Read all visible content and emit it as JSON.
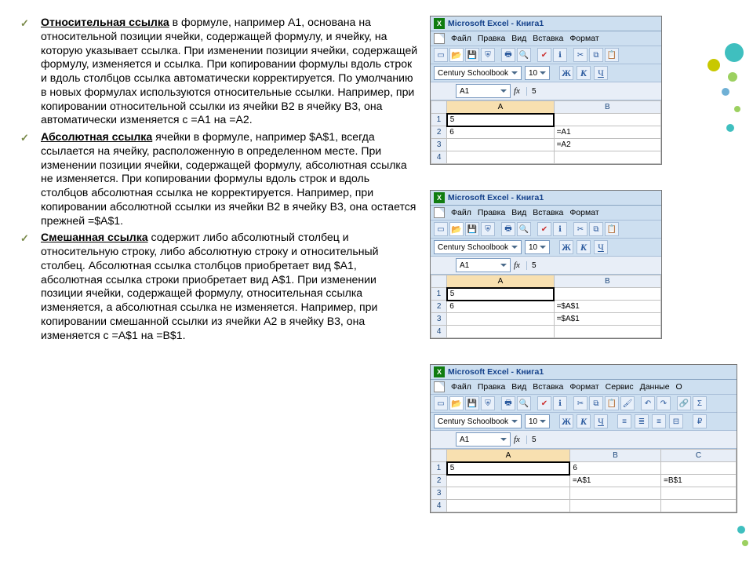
{
  "text": {
    "p1_lead": "Относительная ссылка",
    "p1_body": " в формуле, например A1, основана на относительной позиции ячейки, содержащей формулу, и ячейку, на которую указывает ссылка. При изменении позиции ячейки, содержащей формулу, изменяется и ссылка. При копировании формулы вдоль строк и вдоль столбцов ссылка автоматически корректируется. По умолчанию в новых формулах используются относительные ссылки. Например, при копировании относительной ссылки из ячейки B2 в ячейку B3, она автоматически изменяется с =A1 на =A2.",
    "p2_lead": "Абсолютная ссылка",
    "p2_body": "  ячейки в формуле, например $A$1, всегда ссылается на ячейку, расположенную в определенном месте. При изменении позиции ячейки, содержащей формулу, абсолютная ссылка не изменяется. При копировании формулы вдоль строк и вдоль столбцов абсолютная ссылка не корректируется. Например, при копировании абсолютной ссылки из ячейки B2 в ячейку B3, она остается прежней =$A$1.",
    "p3_lead": "Смешанная ссылка",
    "p3_body": " содержит либо абсолютный столбец и относительную строку, либо абсолютную строку и относительный столбец. Абсолютная ссылка столбцов приобретает вид $A1, абсолютная ссылка строки приобретает вид A$1. При изменении позиции ячейки, содержащей формулу, относительная ссылка изменяется, а абсолютная ссылка не изменяется. Например, при копировании смешанной ссылки из ячейки A2 в ячейку B3, она изменяется с =A$1 на =B$1."
  },
  "excel": {
    "title": "Microsoft Excel - Книга1",
    "menu": [
      "Файл",
      "Правка",
      "Вид",
      "Вставка",
      "Формат"
    ],
    "menu_wide": [
      "Файл",
      "Правка",
      "Вид",
      "Вставка",
      "Формат",
      "Сервис",
      "Данные",
      "О"
    ],
    "font": "Century Schoolbook",
    "size": "10",
    "bold": "Ж",
    "italic": "К",
    "underline": "Ч",
    "namebox": "A1",
    "fx_label": "fx",
    "fx_val": "5"
  },
  "s1": {
    "cols": [
      "A",
      "B"
    ],
    "rows": [
      {
        "n": "1",
        "A": "5",
        "B": ""
      },
      {
        "n": "2",
        "A": "6",
        "B": "=A1"
      },
      {
        "n": "3",
        "A": "",
        "B": "=A2"
      },
      {
        "n": "4",
        "A": "",
        "B": ""
      }
    ]
  },
  "s2": {
    "cols": [
      "A",
      "B"
    ],
    "rows": [
      {
        "n": "1",
        "A": "5",
        "B": ""
      },
      {
        "n": "2",
        "A": "6",
        "B": "=$A$1"
      },
      {
        "n": "3",
        "A": "",
        "B": "=$A$1"
      },
      {
        "n": "4",
        "A": "",
        "B": ""
      }
    ]
  },
  "s3": {
    "cols": [
      "A",
      "B",
      "C"
    ],
    "rows": [
      {
        "n": "1",
        "A": "5",
        "B": "6",
        "C": ""
      },
      {
        "n": "2",
        "A": "",
        "B": "=A$1",
        "C": "=B$1"
      },
      {
        "n": "3",
        "A": "",
        "B": "",
        "C": ""
      },
      {
        "n": "4",
        "A": "",
        "B": "",
        "C": ""
      }
    ]
  }
}
